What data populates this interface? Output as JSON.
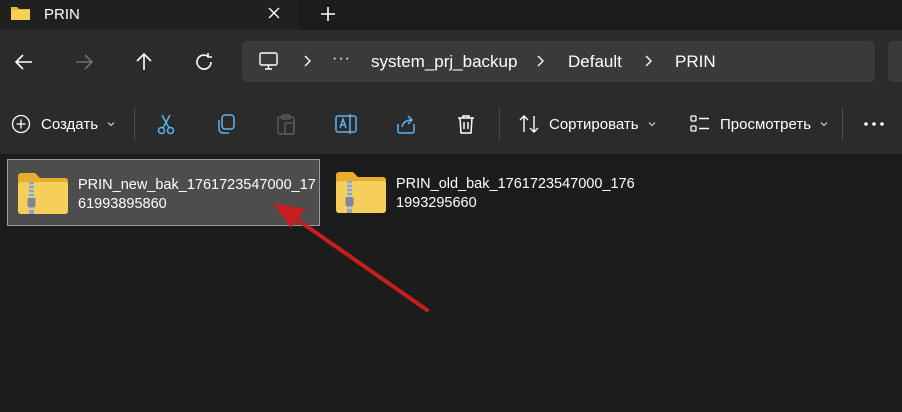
{
  "tab": {
    "title": "PRIN",
    "close_icon": "close-icon",
    "new_tab_icon": "plus-icon"
  },
  "nav": {
    "back_icon": "arrow-left-icon",
    "forward_icon": "arrow-right-icon",
    "up_icon": "arrow-up-icon",
    "refresh_icon": "refresh-icon"
  },
  "address": {
    "root_icon": "computer-icon",
    "overflow": "···",
    "segments": [
      "system_prj_backup",
      "Default",
      "PRIN"
    ]
  },
  "commands": {
    "create_label": "Создать",
    "sort_label": "Сортировать",
    "view_label": "Просмотреть",
    "more_icon": "more-icon"
  },
  "files": [
    {
      "name": "PRIN_new_bak_1761723547000_1761993895860",
      "selected": true
    },
    {
      "name": "PRIN_old_bak_1761723547000_1761993295660",
      "selected": false
    }
  ],
  "colors": {
    "background": "#1c1c1c",
    "toolbar": "#2b2b2b",
    "address_bar": "#3a3a3a",
    "selection": "#4d4d4d",
    "folder_yellow": "#f4c74a",
    "annotation_arrow": "#c81e1e"
  }
}
